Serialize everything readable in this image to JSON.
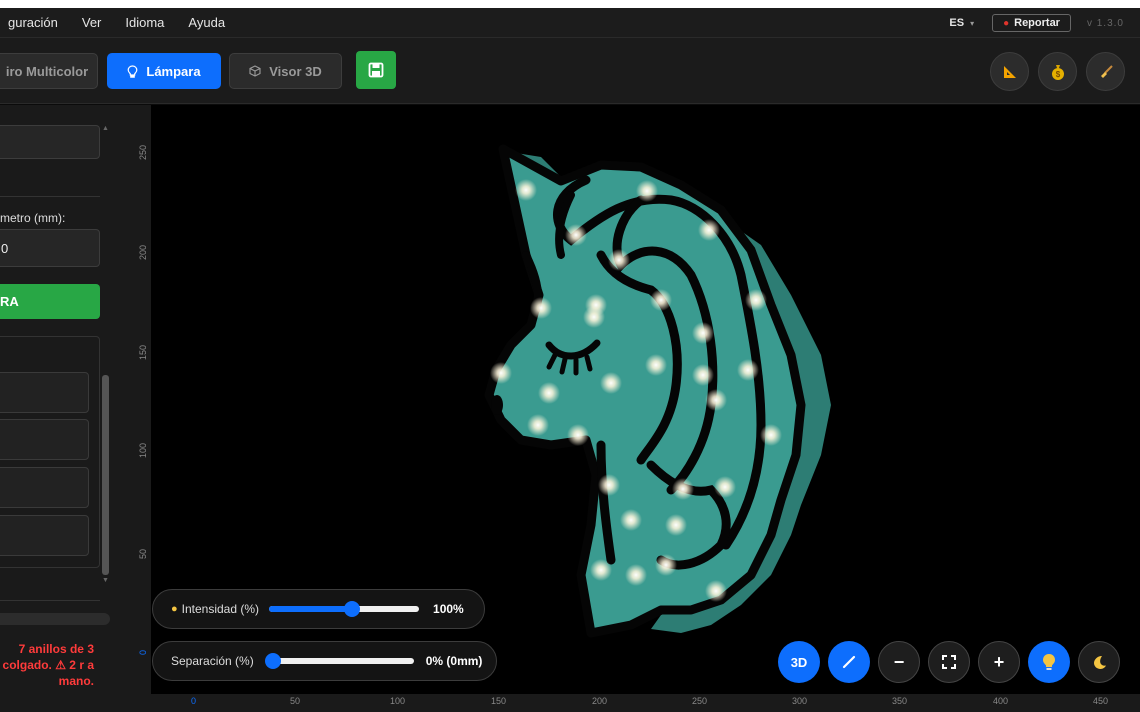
{
  "menu": {
    "items": [
      "guración",
      "Ver",
      "Idioma",
      "Ayuda"
    ],
    "language": "ES",
    "report_label": "Reportar",
    "version": "v 1.3.0"
  },
  "toolbar": {
    "tabs": [
      {
        "label": "iro Multicolor",
        "icon": "none",
        "active": false
      },
      {
        "label": "Lámpara",
        "icon": "bulb-icon",
        "active": true
      },
      {
        "label": "Visor 3D",
        "icon": "cube-icon",
        "active": false
      }
    ],
    "save_icon": "floppy-disk-icon",
    "right_tools": [
      "set-square-icon",
      "money-bag-icon",
      "broom-icon"
    ]
  },
  "sidebar": {
    "diameter_label": "metro (mm):",
    "diameter_value": "0",
    "green_button_label": "RA",
    "warning_text": "7 anillos de 3 colgado. ⚠ 2 r a mano."
  },
  "canvas": {
    "ruler_vertical": [
      "250",
      "200",
      "150",
      "100",
      "50",
      "0"
    ],
    "ruler_horizontal": [
      "0",
      "50",
      "100",
      "150",
      "200",
      "250",
      "300",
      "350",
      "400",
      "450"
    ],
    "intensity": {
      "label": "Intensidad (%)",
      "value_text": "100%",
      "value": 0.55
    },
    "separation": {
      "label": "Separación (%)",
      "value_text": "0% (0mm)",
      "value": 0.05
    },
    "controls": [
      {
        "name": "view-3d-button",
        "label": "3D",
        "style": "blue"
      },
      {
        "name": "draw-button",
        "label": "",
        "style": "blue"
      },
      {
        "name": "zoom-out-button",
        "label": "−",
        "style": "dark"
      },
      {
        "name": "fit-view-button",
        "label": "",
        "style": "dark"
      },
      {
        "name": "zoom-in-button",
        "label": "+",
        "style": "dark"
      },
      {
        "name": "light-toggle-button",
        "label": "",
        "style": "blue"
      },
      {
        "name": "night-mode-button",
        "label": "",
        "style": "dark"
      }
    ]
  },
  "colors": {
    "accent": "#0d6efd",
    "success": "#28a745",
    "lamp_body": "#3a9b90",
    "lamp_side": "#2d7d74",
    "outline": "#050505",
    "warning": "#ff3b3b"
  }
}
